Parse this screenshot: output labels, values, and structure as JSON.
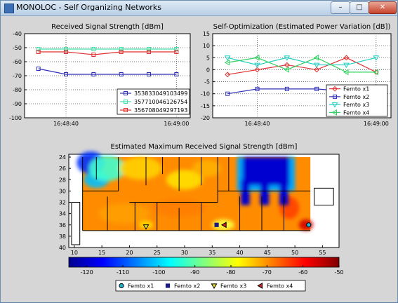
{
  "window": {
    "title": "MONOLOC - Self Organizing Networks",
    "buttons": {
      "minimize": "–",
      "maximize": "□",
      "close": "✕"
    }
  },
  "colors": {
    "window_bg": "#d6d6d6",
    "plot_bg": "#ffffff",
    "grid": "#555555"
  },
  "chart_data": [
    {
      "type": "line",
      "title": "Received Signal Strength  [dBm]",
      "xlabel": "",
      "ylabel": "",
      "x": [
        "16:48:35",
        "16:48:40",
        "16:48:45",
        "16:48:50",
        "16:48:55",
        "16:49:00"
      ],
      "xticks": [
        "16:48:40",
        "16:49:00"
      ],
      "ylim": [
        -100,
        -40
      ],
      "yticks": [
        -40,
        -50,
        -60,
        -70,
        -80,
        -90,
        -100
      ],
      "grid": true,
      "legend_position": "bottom-right",
      "series": [
        {
          "name": "353833049103499",
          "color": "#2f2fb8",
          "marker": "square",
          "values": [
            -65,
            -69,
            -69,
            -69,
            -69,
            -69
          ]
        },
        {
          "name": "357710046126754",
          "color": "#40e0a8",
          "marker": "square",
          "values": [
            -51,
            -51,
            -51,
            -51,
            -51,
            -51
          ]
        },
        {
          "name": "356708049297193",
          "color": "#e03030",
          "marker": "square",
          "values": [
            -53,
            -53,
            -55,
            -53,
            -53,
            -53
          ]
        }
      ]
    },
    {
      "type": "line",
      "title": "Self-Optimization (Estimated Power Variation [dB])",
      "xlabel": "",
      "ylabel": "",
      "x": [
        "16:48:35",
        "16:48:40",
        "16:48:45",
        "16:48:50",
        "16:48:55",
        "16:49:00"
      ],
      "xticks": [
        "16:48:40",
        "16:49:00"
      ],
      "ylim": [
        -20,
        15
      ],
      "yticks": [
        15,
        10,
        5,
        0,
        -5,
        -10,
        -15,
        -20
      ],
      "grid": true,
      "legend_position": "bottom-right",
      "series": [
        {
          "name": "Femto x1",
          "color": "#e03030",
          "marker": "diamond",
          "values": [
            -2,
            0,
            2,
            0,
            5,
            -1
          ]
        },
        {
          "name": "Femto x2",
          "color": "#2f2fb8",
          "marker": "square",
          "values": [
            -10,
            -8,
            -8,
            -8,
            -9,
            -9
          ]
        },
        {
          "name": "Femto x3",
          "color": "#20d0c0",
          "marker": "triangle-down",
          "values": [
            5,
            2,
            5,
            2,
            2,
            5
          ]
        },
        {
          "name": "Femto x4",
          "color": "#30d060",
          "marker": "triangle-left",
          "values": [
            3,
            5,
            0,
            5,
            -1,
            -1
          ]
        }
      ]
    },
    {
      "type": "heatmap",
      "title": "Estimated Maximum Received Signal Strength [dBm]",
      "xticks": [
        10,
        15,
        20,
        25,
        30,
        35,
        40,
        45,
        50,
        55
      ],
      "yticks": [
        24,
        26,
        28,
        30,
        32,
        34,
        36,
        38,
        40
      ],
      "xlim": [
        9,
        58
      ],
      "ylim": [
        23.5,
        40
      ],
      "colorbar": {
        "range": [
          -125,
          -50
        ],
        "ticks": [
          -120,
          -110,
          -100,
          -90,
          -80,
          -70,
          -60,
          -50
        ]
      },
      "femtos": [
        {
          "name": "Femto x1",
          "marker": "circle",
          "color": "#20b0d0",
          "x": 52.5,
          "y": 36
        },
        {
          "name": "Femto x2",
          "marker": "square",
          "color": "#1a1a80",
          "x": 35.8,
          "y": 36
        },
        {
          "name": "Femto x3",
          "marker": "triangle-down",
          "color": "#e8e030",
          "x": 23,
          "y": 36.3
        },
        {
          "name": "Femto x4",
          "marker": "triangle-left",
          "color": "#d02020",
          "x": 37.2,
          "y": 36
        }
      ]
    }
  ]
}
